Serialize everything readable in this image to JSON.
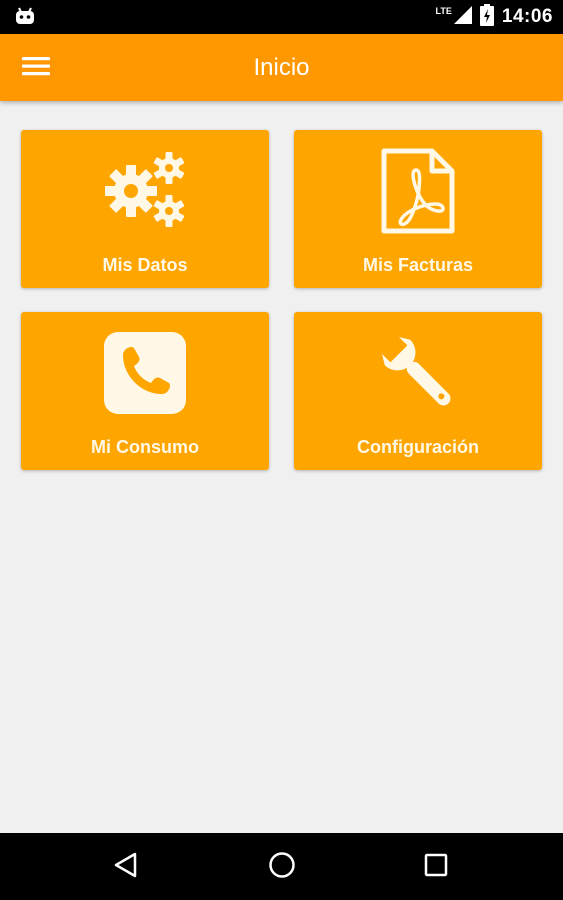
{
  "status_bar": {
    "network": "LTE",
    "time": "14:06"
  },
  "app_bar": {
    "title": "Inicio",
    "menu_icon": "hamburger-menu-icon"
  },
  "tiles": [
    {
      "label": "Mis Datos",
      "icon": "gears-icon"
    },
    {
      "label": "Mis Facturas",
      "icon": "pdf-document-icon"
    },
    {
      "label": "Mi Consumo",
      "icon": "phone-icon"
    },
    {
      "label": "Configuración",
      "icon": "wrench-icon"
    }
  ],
  "colors": {
    "app_bar": "#ff9800",
    "tile": "#ffa500",
    "tile_content": "#fff8e6",
    "background": "#f0f0f0"
  }
}
